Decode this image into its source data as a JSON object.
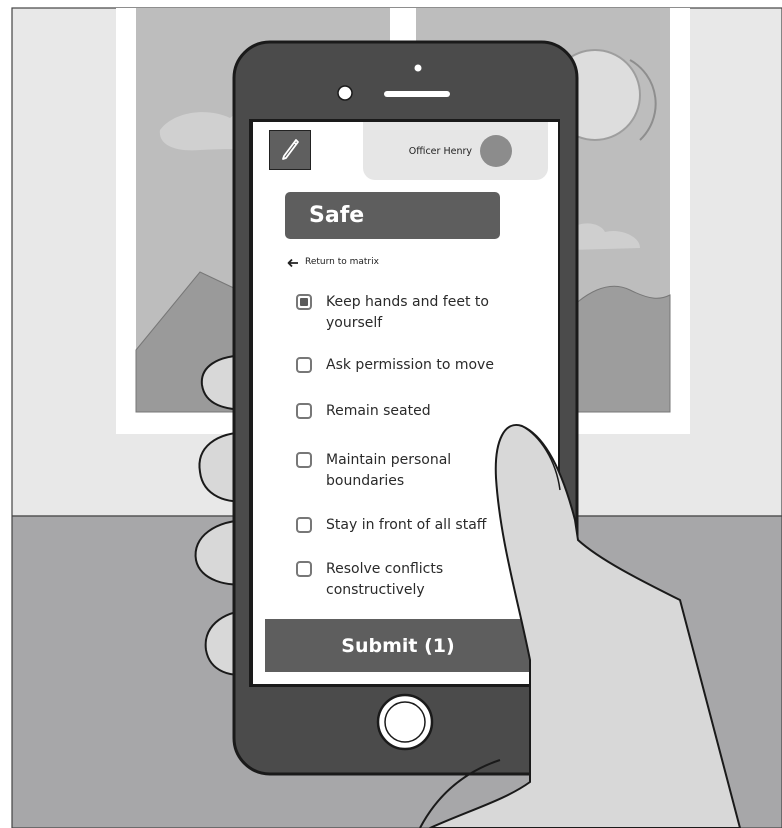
{
  "header": {
    "edit_icon": "pencil-icon",
    "officer_name": "Officer Henry"
  },
  "category": {
    "title": "Safe"
  },
  "navigation": {
    "back_label": "Return to matrix",
    "back_icon": "arrow-left-icon"
  },
  "behaviors": [
    {
      "label": "Keep hands and feet to yourself",
      "checked": true
    },
    {
      "label": "Ask permission to move",
      "checked": false
    },
    {
      "label": "Remain seated",
      "checked": false
    },
    {
      "label": "Maintain personal boundaries",
      "checked": false
    },
    {
      "label": "Stay in front of all staff",
      "checked": false
    },
    {
      "label": "Resolve conflicts constructively",
      "checked": false
    }
  ],
  "submit": {
    "label": "Submit (1)"
  },
  "colors": {
    "accent": "#5e5e5e",
    "screen_bg": "#ffffff",
    "card_bg": "#e6e6e6"
  }
}
